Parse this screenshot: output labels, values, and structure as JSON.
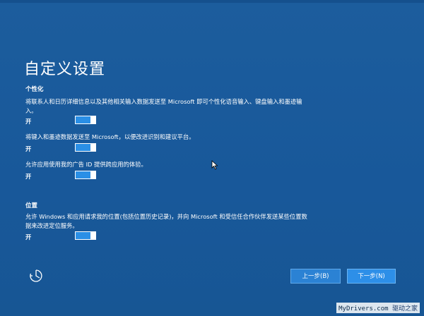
{
  "page": {
    "title": "自定义设置"
  },
  "personalization": {
    "heading": "个性化",
    "items": [
      {
        "description": "将联系人和日历详细信息以及其他相关输入数据发送至 Microsoft 即可个性化语音输入、键盘输入和墨迹输入。",
        "toggle_label": "开",
        "on": true
      },
      {
        "description": "将键入和墨迹数据发送至 Microsoft，以便改进识别和建议平台。",
        "toggle_label": "开",
        "on": true
      },
      {
        "description": "允许应用使用我的广告 ID 提供跨应用的体验。",
        "toggle_label": "开",
        "on": true
      }
    ]
  },
  "location": {
    "heading": "位置",
    "items": [
      {
        "description": "允许 Windows 和应用请求我的位置(包括位置历史记录)，并向 Microsoft 和受信任合作伙伴发送某些位置数据来改进定位服务。",
        "toggle_label": "开",
        "on": true
      }
    ]
  },
  "footer": {
    "back_label": "上一步(B)",
    "next_label": "下一步(N)",
    "accessibility_icon": "ease-of-access-icon"
  },
  "watermark": {
    "site": "MyDrivers.com",
    "brand": "驱动之家"
  },
  "colors": {
    "background": "#1a5a9a",
    "toggle_on": "#2a8fe6",
    "next_button": "#2d8fe8"
  }
}
